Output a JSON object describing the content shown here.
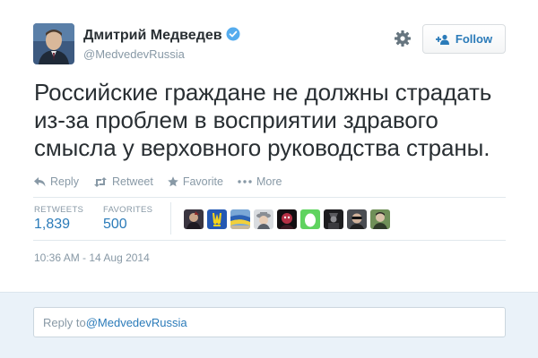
{
  "tweet": {
    "author_name": "Дмитрий Медведев",
    "author_handle": "@MedvedevRussia",
    "follow_label": "Follow",
    "text": "Российские граждане не должны страдать из-за проблем в восприятии здравого смысла у верховного руководства страны.",
    "actions": {
      "reply": "Reply",
      "retweet": "Retweet",
      "favorite": "Favorite",
      "more": "More"
    },
    "stats": {
      "retweets_label": "RETWEETS",
      "retweets_value": "1,839",
      "favorites_label": "FAVORITES",
      "favorites_value": "500"
    },
    "favoriters": [
      {
        "icon": "avatar-dark"
      },
      {
        "icon": "avatar-trident"
      },
      {
        "icon": "avatar-flag-ukraine"
      },
      {
        "icon": "avatar-hat"
      },
      {
        "icon": "avatar-red-dark"
      },
      {
        "icon": "avatar-egg"
      },
      {
        "icon": "avatar-dark-figure"
      },
      {
        "icon": "avatar-sunglasses"
      },
      {
        "icon": "avatar-green-portrait"
      }
    ],
    "timestamp": "10:36 AM - 14 Aug 2014"
  },
  "reply": {
    "prefix": "Reply to ",
    "mention": "@MedvedevRussia"
  },
  "colors": {
    "link": "#2b7bb9",
    "muted": "#8899a6",
    "verified": "#55acee",
    "reply_bg": "#eaf2f9"
  }
}
